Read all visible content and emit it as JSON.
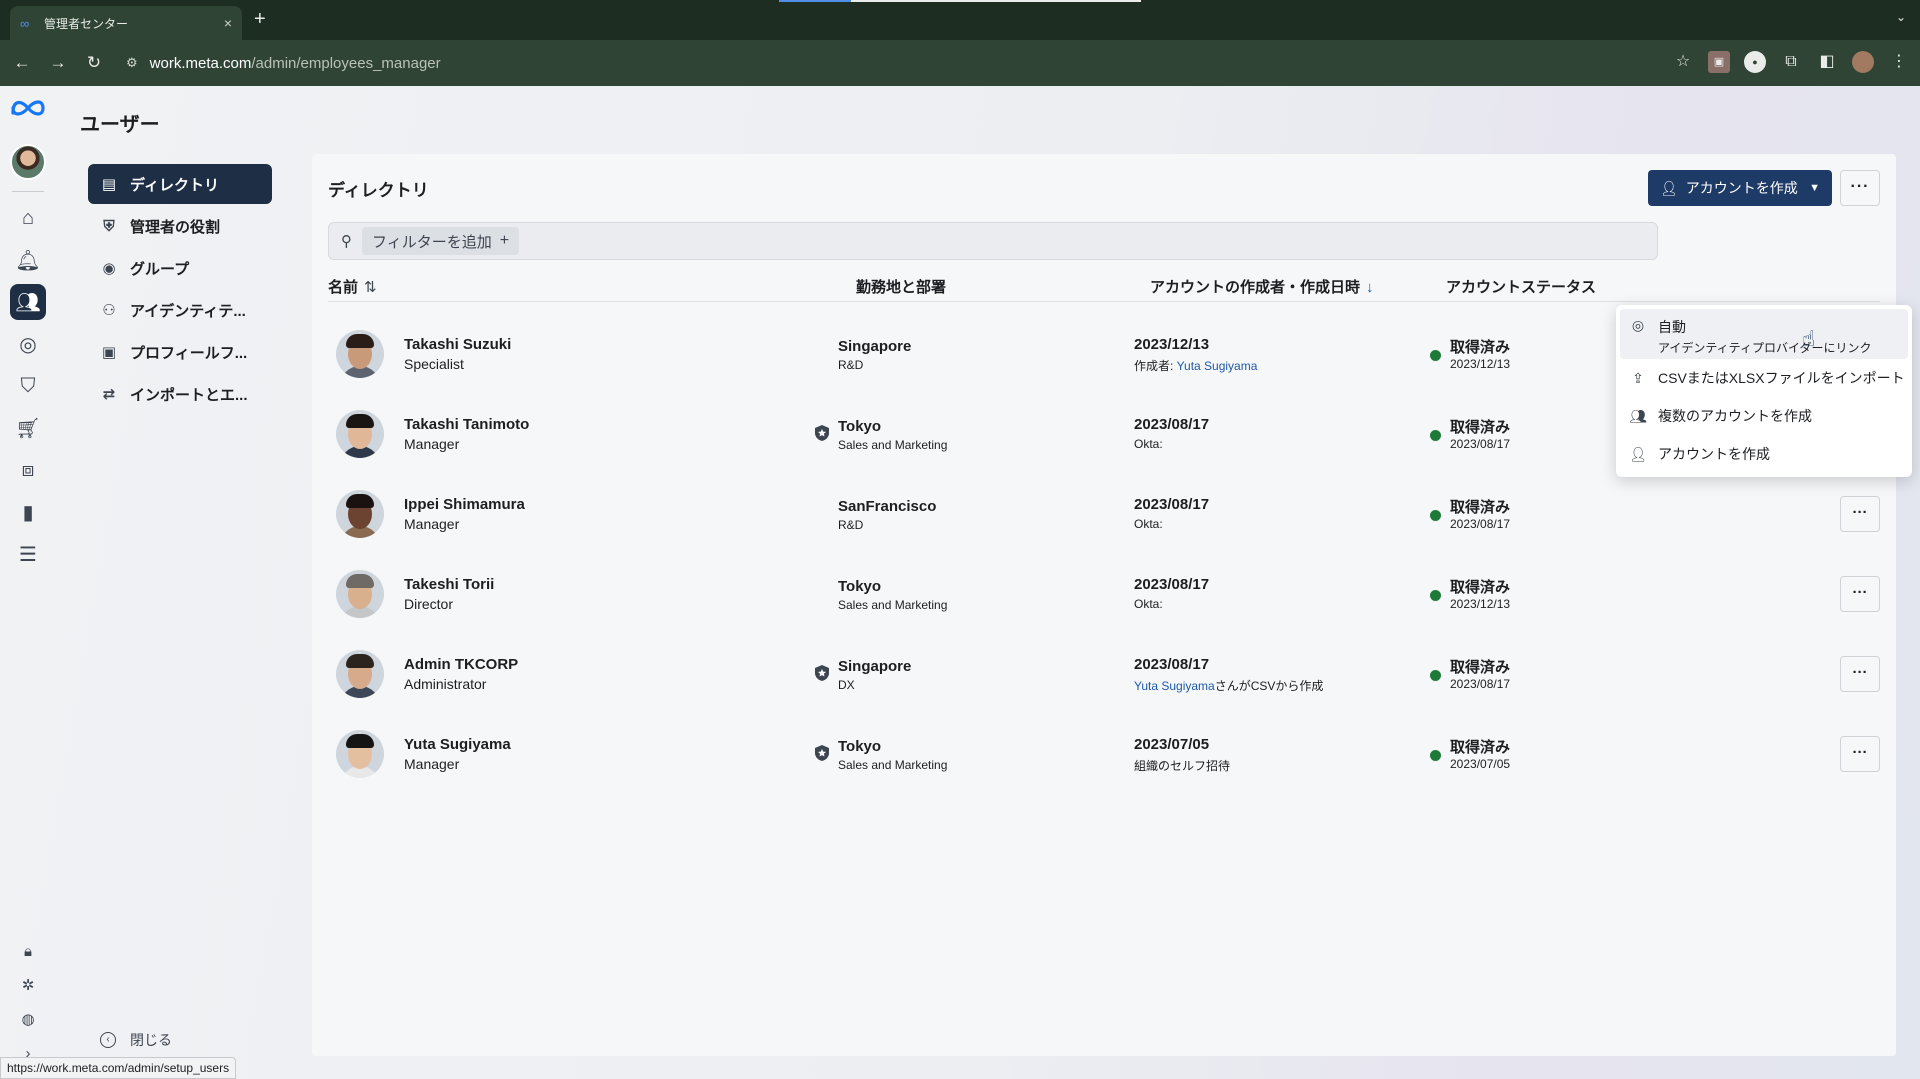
{
  "browser": {
    "tab_title": "管理者センター",
    "url_domain": "work.meta.com",
    "url_path": "/admin/employees_manager",
    "status_url": "https://work.meta.com/admin/setup_users"
  },
  "page": {
    "heading": "ユーザー",
    "close_label": "閉じる"
  },
  "subnav": [
    {
      "label": "ディレクトリ",
      "icon": "directory-icon",
      "active": true
    },
    {
      "label": "管理者の役割",
      "icon": "admin-role-icon"
    },
    {
      "label": "グループ",
      "icon": "groups-icon"
    },
    {
      "label": "アイデンティテ...",
      "icon": "identity-icon"
    },
    {
      "label": "プロフィールフ...",
      "icon": "profile-field-icon"
    },
    {
      "label": "インポートとエ...",
      "icon": "import-export-icon"
    }
  ],
  "directory": {
    "title": "ディレクトリ",
    "create_label": "アカウントを作成",
    "filter_label": "フィルターを追加",
    "columns": {
      "name": "名前",
      "location": "勤務地と部署",
      "created": "アカウントの作成者・作成日時",
      "status": "アカウントステータス"
    }
  },
  "users": [
    {
      "name": "Takashi Suzuki",
      "role": "Specialist",
      "admin": false,
      "location": "Singapore",
      "dept": "R&D",
      "created_date": "2023/12/13",
      "created_prefix": "作成者: ",
      "created_link": "Yuta Sugiyama",
      "created_suffix": "",
      "status": "取得済み",
      "status_date": "2023/12/13"
    },
    {
      "name": "Takashi Tanimoto",
      "role": "Manager",
      "admin": true,
      "location": "Tokyo",
      "dept": "Sales and Marketing",
      "created_date": "2023/08/17",
      "created_prefix": "Okta:",
      "created_link": "",
      "created_suffix": "",
      "status": "取得済み",
      "status_date": "2023/08/17"
    },
    {
      "name": "Ippei Shimamura",
      "role": "Manager",
      "admin": false,
      "location": "SanFrancisco",
      "dept": "R&D",
      "created_date": "2023/08/17",
      "created_prefix": "Okta:",
      "created_link": "",
      "created_suffix": "",
      "status": "取得済み",
      "status_date": "2023/08/17"
    },
    {
      "name": "Takeshi Torii",
      "role": "Director",
      "admin": false,
      "location": "Tokyo",
      "dept": "Sales and Marketing",
      "created_date": "2023/08/17",
      "created_prefix": "Okta:",
      "created_link": "",
      "created_suffix": "",
      "status": "取得済み",
      "status_date": "2023/12/13"
    },
    {
      "name": "Admin TKCORP",
      "role": "Administrator",
      "admin": true,
      "location": "Singapore",
      "dept": "DX",
      "created_date": "2023/08/17",
      "created_prefix": "",
      "created_link": "Yuta Sugiyama",
      "created_suffix": "さんがCSVから作成",
      "status": "取得済み",
      "status_date": "2023/08/17"
    },
    {
      "name": "Yuta Sugiyama",
      "role": "Manager",
      "admin": true,
      "location": "Tokyo",
      "dept": "Sales and Marketing",
      "created_date": "2023/07/05",
      "created_prefix": "組織のセルフ招待",
      "created_link": "",
      "created_suffix": "",
      "status": "取得済み",
      "status_date": "2023/07/05"
    }
  ],
  "dropdown": {
    "auto_title": "自動",
    "auto_sub": "アイデンティティプロバイダーにリンク",
    "import": "CSVまたはXLSXファイルをインポート",
    "multiple": "複数のアカウントを作成",
    "single": "アカウントを作成"
  },
  "colors": {
    "accent_navy": "#1e3a66",
    "active_nav": "#1e2f45",
    "status_green": "#1f7a3a",
    "link_blue": "#1e5aa8"
  }
}
